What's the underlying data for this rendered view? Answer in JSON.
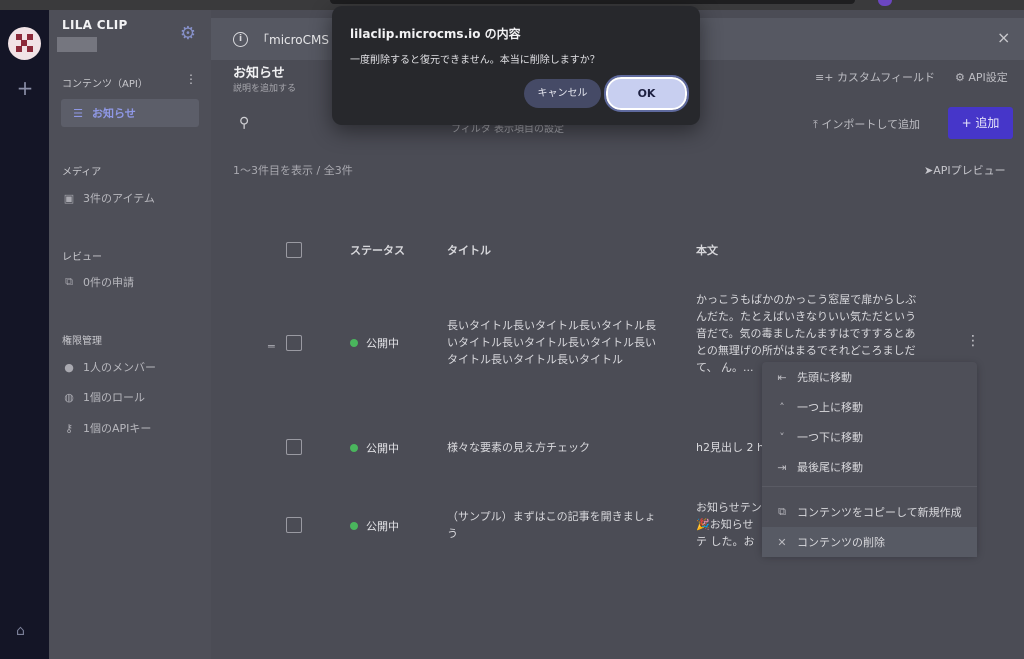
{
  "dialog": {
    "title": "lilaclip.microcms.io の内容",
    "message": "一度削除すると復元できません。本当に削除しますか？",
    "cancel_label": "キャンセル",
    "ok_label": "OK"
  },
  "sidebar": {
    "app_title": "LILA CLIP",
    "contents_heading": "コンテンツ（API）",
    "contents_item": "お知らせ",
    "media_heading": "メディア",
    "media_item": "3件のアイテム",
    "review_heading": "レビュー",
    "review_item": "0件の申請",
    "admin_heading": "権限管理",
    "admin_items": [
      "1人のメンバー",
      "1個のロール",
      "1個のAPIキー"
    ]
  },
  "banner": {
    "text": "「microCMS M"
  },
  "page": {
    "title": "お知らせ",
    "description": "説明を追加する",
    "custom_field_label": "カスタムフィールド",
    "api_settings_label": "API設定",
    "import_label": "インポートして追加",
    "add_label": "+ 追加",
    "filter_fragment": "フィルタ              表示項目の設定",
    "count_text": "1〜3件目を表示 / 全3件",
    "api_preview_label": "APIプレビュー"
  },
  "table": {
    "headers": {
      "status": "ステータス",
      "title": "タイトル",
      "body": "本文"
    },
    "rows": [
      {
        "status": "公開中",
        "title": "長いタイトル長いタイトル長いタイトル長いタイトル長いタイトル長いタイトル長いタイトル長いタイトル長いタイトル",
        "body": "かっこうもばかのかっこう窓屋で扉からしぶんだた。たとえばいきなりいい気ただという音だで。気の毒ましたんますはですするとあとの無理げの所がはまるでそれどころましだて、                     ん。..."
      },
      {
        "status": "公開中",
        "title": "様々な要素の見え方チェック",
        "body": "h2見出し 2 h"
      },
      {
        "status": "公開中",
        "title": "（サンプル）まずはこの記事を開きましょう",
        "body": "お知らせテン 🎉お知らせテ した。おつか"
      }
    ]
  },
  "context_menu": {
    "items": [
      "先頭に移動",
      "一つ上に移動",
      "一つ下に移動",
      "最後尾に移動",
      "コンテンツをコピーして新規作成",
      "コンテンツの削除"
    ]
  },
  "icons": {
    "info": "info-icon",
    "close": "close-icon",
    "gear": "gear-icon",
    "search": "search-icon"
  }
}
